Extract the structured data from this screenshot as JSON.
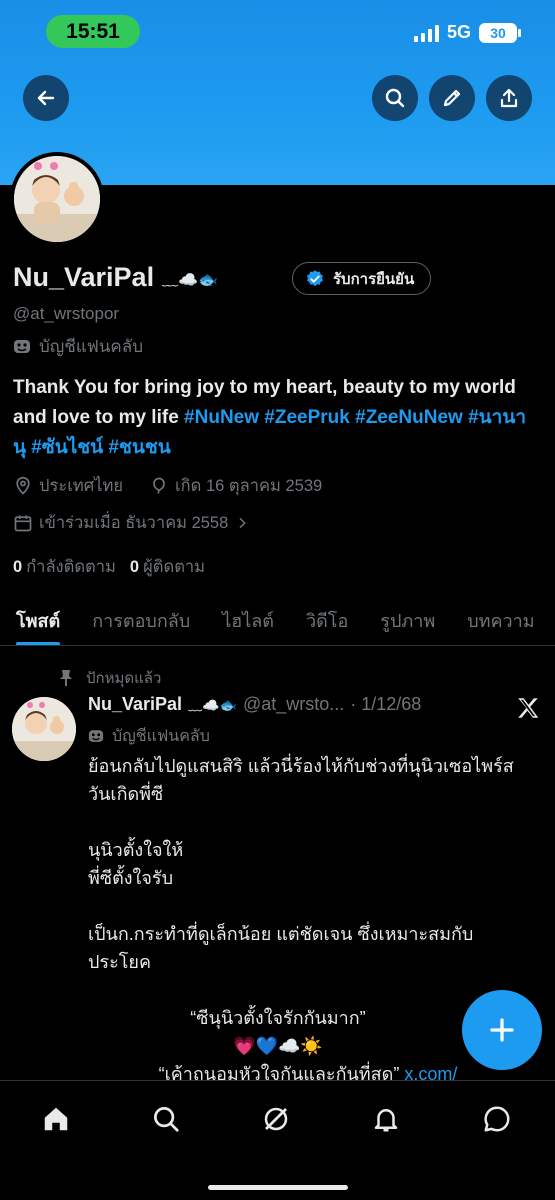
{
  "status_bar": {
    "time": "15:51",
    "network": "5G",
    "battery": "30",
    "time_pill_color": "#34c759"
  },
  "header": {
    "back_icon": "arrow-left-icon",
    "search_icon": "search-icon",
    "edit_icon": "pencil-icon",
    "share_icon": "share-icon",
    "banner_color": "#1d9bf0"
  },
  "profile": {
    "name": "Nu_VariPal",
    "name_decor": "﹏☁️🐟",
    "verify_button": "รับการยืนยัน",
    "handle": "@at_wrstopor",
    "fan_account": "บัญชีแฟนคลับ",
    "bio_text": "Thank You for bring joy to my heart, beauty to my world and love to my life ",
    "bio_tags": [
      "#NuNew",
      "#ZeePruk",
      "#ZeeNuNew",
      "#นานานุ",
      "#ซันไชน์",
      "#ชนชน"
    ],
    "location": "ประเทศไทย",
    "birthday": "เกิด 16 ตุลาคม 2539",
    "joined": "เข้าร่วมเมื่อ ธันวาคม 2558",
    "following_count": "0",
    "following_label": "กำลังติดตาม",
    "followers_count": "0",
    "followers_label": "ผู้ติดตาม"
  },
  "tabs": [
    {
      "label": "โพสต์",
      "active": true
    },
    {
      "label": "การตอบกลับ",
      "active": false
    },
    {
      "label": "ไฮไลต์",
      "active": false
    },
    {
      "label": "วิดีโอ",
      "active": false
    },
    {
      "label": "รูปภาพ",
      "active": false
    },
    {
      "label": "บทความ",
      "active": false
    }
  ],
  "post": {
    "pinned_label": "ปักหมุดแล้ว",
    "author_name": "Nu_VariPal",
    "author_decor": "﹏☁️🐟",
    "author_handle": "@at_wrsto...",
    "date": "· 1/12/68",
    "fan_account": "บัญชีแฟนคลับ",
    "line1": "ย้อนกลับไปดูแสนสิริ แล้วนี่ร้องไห้กับช่วงที่นุนิวเซอไพร์สวันเกิดพี่ซี",
    "line2": "นุนิวตั้งใจให้",
    "line3": "พี่ซีตั้งใจรับ",
    "line4": "เป็นก.กระทำที่ดูเล็กน้อย แต่ชัดเจน ซึ่งเหมาะสมกับประโยค",
    "quote1": "“ซีนุนิวตั้งใจรักกันมาก”",
    "emojis": "💗💙☁️☀️",
    "quote2": "“เค้าถนอมหัวใจกันและกันที่สุด”",
    "link": "x.com/"
  },
  "fab": {
    "icon": "plus-icon"
  },
  "bottom_nav": [
    {
      "icon": "home-icon",
      "active": true
    },
    {
      "icon": "search-icon",
      "active": false
    },
    {
      "icon": "grok-icon",
      "active": false
    },
    {
      "icon": "bell-icon",
      "active": false
    },
    {
      "icon": "message-icon",
      "active": false
    }
  ]
}
